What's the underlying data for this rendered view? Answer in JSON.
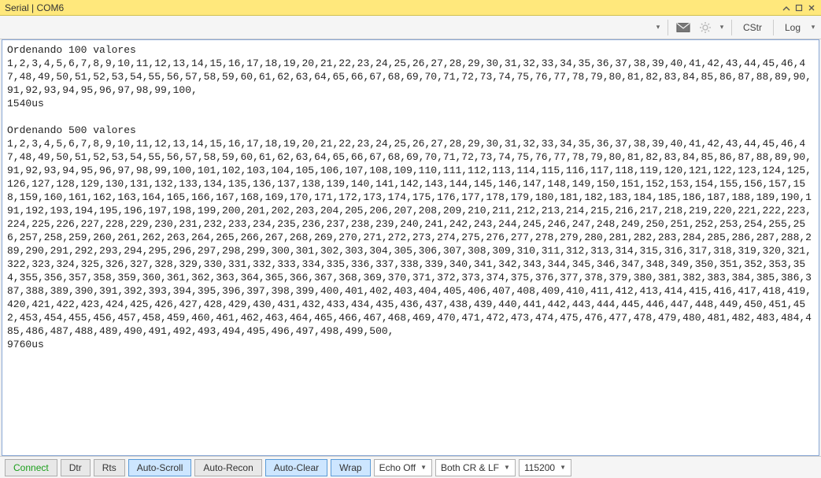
{
  "window": {
    "title": "Serial | COM6"
  },
  "toolbar": {
    "cstr_label": "CStr",
    "log_label": "Log"
  },
  "console": {
    "text": "Ordenando 100 valores\n1,2,3,4,5,6,7,8,9,10,11,12,13,14,15,16,17,18,19,20,21,22,23,24,25,26,27,28,29,30,31,32,33,34,35,36,37,38,39,40,41,42,43,44,45,46,47,48,49,50,51,52,53,54,55,56,57,58,59,60,61,62,63,64,65,66,67,68,69,70,71,72,73,74,75,76,77,78,79,80,81,82,83,84,85,86,87,88,89,90,91,92,93,94,95,96,97,98,99,100,\n1540us\n\nOrdenando 500 valores\n1,2,3,4,5,6,7,8,9,10,11,12,13,14,15,16,17,18,19,20,21,22,23,24,25,26,27,28,29,30,31,32,33,34,35,36,37,38,39,40,41,42,43,44,45,46,47,48,49,50,51,52,53,54,55,56,57,58,59,60,61,62,63,64,65,66,67,68,69,70,71,72,73,74,75,76,77,78,79,80,81,82,83,84,85,86,87,88,89,90,91,92,93,94,95,96,97,98,99,100,101,102,103,104,105,106,107,108,109,110,111,112,113,114,115,116,117,118,119,120,121,122,123,124,125,126,127,128,129,130,131,132,133,134,135,136,137,138,139,140,141,142,143,144,145,146,147,148,149,150,151,152,153,154,155,156,157,158,159,160,161,162,163,164,165,166,167,168,169,170,171,172,173,174,175,176,177,178,179,180,181,182,183,184,185,186,187,188,189,190,191,192,193,194,195,196,197,198,199,200,201,202,203,204,205,206,207,208,209,210,211,212,213,214,215,216,217,218,219,220,221,222,223,224,225,226,227,228,229,230,231,232,233,234,235,236,237,238,239,240,241,242,243,244,245,246,247,248,249,250,251,252,253,254,255,256,257,258,259,260,261,262,263,264,265,266,267,268,269,270,271,272,273,274,275,276,277,278,279,280,281,282,283,284,285,286,287,288,289,290,291,292,293,294,295,296,297,298,299,300,301,302,303,304,305,306,307,308,309,310,311,312,313,314,315,316,317,318,319,320,321,322,323,324,325,326,327,328,329,330,331,332,333,334,335,336,337,338,339,340,341,342,343,344,345,346,347,348,349,350,351,352,353,354,355,356,357,358,359,360,361,362,363,364,365,366,367,368,369,370,371,372,373,374,375,376,377,378,379,380,381,382,383,384,385,386,387,388,389,390,391,392,393,394,395,396,397,398,399,400,401,402,403,404,405,406,407,408,409,410,411,412,413,414,415,416,417,418,419,420,421,422,423,424,425,426,427,428,429,430,431,432,433,434,435,436,437,438,439,440,441,442,443,444,445,446,447,448,449,450,451,452,453,454,455,456,457,458,459,460,461,462,463,464,465,466,467,468,469,470,471,472,473,474,475,476,477,478,479,480,481,482,483,484,485,486,487,488,489,490,491,492,493,494,495,496,497,498,499,500,\n9760us\n"
  },
  "statusbar": {
    "connect_label": "Connect",
    "dtr_label": "Dtr",
    "rts_label": "Rts",
    "autoscroll_label": "Auto-Scroll",
    "autorecon_label": "Auto-Recon",
    "autoclear_label": "Auto-Clear",
    "wrap_label": "Wrap",
    "echo_label": "Echo Off",
    "lineending_label": "Both CR & LF",
    "baud_value": "115200"
  }
}
